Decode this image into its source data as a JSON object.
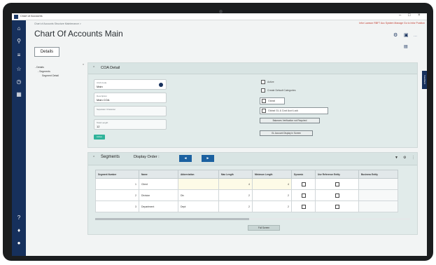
{
  "window": {
    "title": "Chart of Accounts",
    "controls": [
      "–",
      "□",
      "×"
    ]
  },
  "top_links": "Infor Lawson RBF7 Acc  System Manage  Go to Infor  Position",
  "breadcrumb": "Chart of Accounts Structure Maintenance  >",
  "page_title": "Chart Of Accounts Main",
  "details_button": "Details",
  "tree": {
    "root": "Details",
    "child": "Segments",
    "grandchild": "Segment Detail"
  },
  "feedback_tab": "Feedback",
  "coa_detail": {
    "title": "COA Detail",
    "fields": [
      {
        "label": "COA Code",
        "value": "Main"
      },
      {
        "label": "Description",
        "value": "Main COA"
      },
      {
        "label": "Separator Character",
        "value": ""
      },
      {
        "label": "Total Length",
        "value": "12"
      }
    ],
    "active_badge": "Active",
    "checkboxes": {
      "active": "Active",
      "create_default": "Create Default Categories",
      "global": "Global",
      "global_gl": "Global GL & Cost Acct Lock"
    },
    "buttons": {
      "balances": "Balances Verification not Required",
      "gl_display": "GL Account Display in Screen"
    }
  },
  "segments": {
    "title": "Segments",
    "display_order_label": "Display Order :",
    "order_buttons": [
      "◄",
      "►"
    ],
    "columns": [
      "Segment Number",
      "Name",
      "Abbreviation",
      "Max Length",
      "Minimum Length",
      "Dynamic",
      "Use Reference Entity",
      "Business Entity"
    ],
    "rows": [
      {
        "number": "1",
        "name": "Client",
        "abbr": "",
        "max": "4",
        "min": "4"
      },
      {
        "number": "2",
        "name": "Division",
        "abbr": "Div",
        "max": "2",
        "min": "2"
      },
      {
        "number": "3",
        "name": "Department",
        "abbr": "Dept",
        "max": "2",
        "min": "2"
      }
    ],
    "full_screen_button": "Full Screen"
  },
  "colors": {
    "sidebar": "#16305c",
    "accent_teal": "#2fb39a",
    "blue_button": "#1b61a0",
    "panel_bg": "#e1ebea"
  }
}
